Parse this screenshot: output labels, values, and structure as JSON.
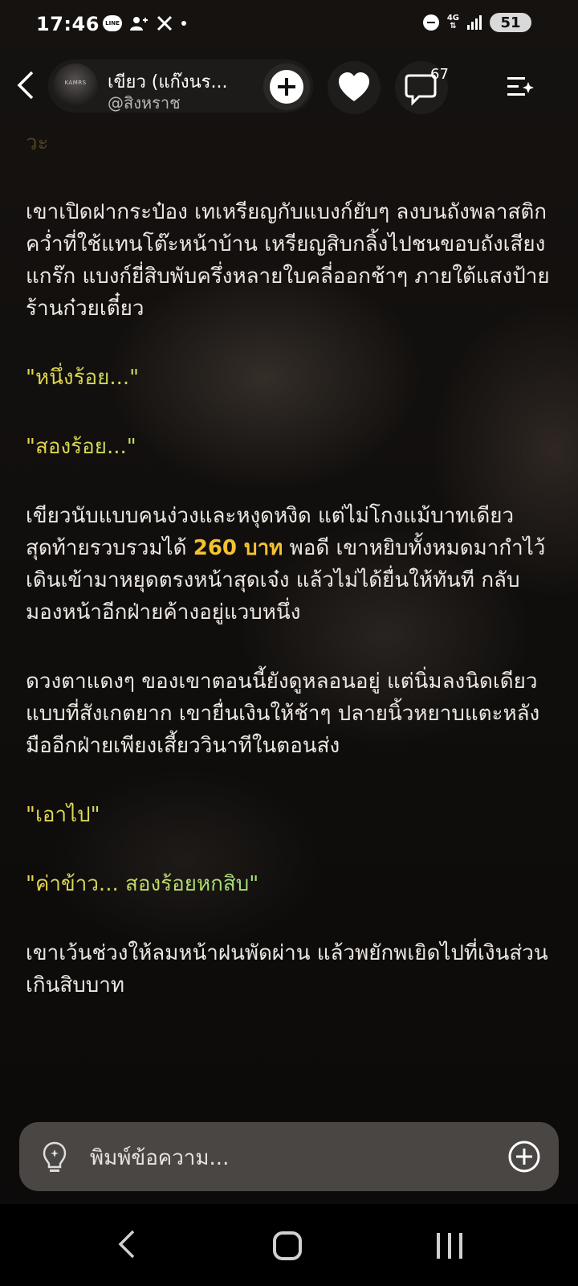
{
  "status_bar": {
    "time": "17:46",
    "line_label": "LINE",
    "network": "4G",
    "battery": "51",
    "icons": [
      "line-icon",
      "person-add-icon",
      "x-icon",
      "dot-icon",
      "dnd-icon",
      "network-icon",
      "signal-icon",
      "battery-icon"
    ]
  },
  "header": {
    "name": "เขียว (แก๊งนร...",
    "handle": "@สิงหราช",
    "comment_count": "67",
    "avatar_text": "KAMRS"
  },
  "content": {
    "faded_line": "วะ",
    "p1": "เขาเปิดฝากระป๋อง เทเหรียญกับแบงก์ยับๆ ลงบนถังพลาสติกคว่ำที่ใช้แทนโต๊ะหน้าบ้าน เหรียญสิบกลิ้งไปชนขอบถังเสียงแกร๊ก แบงก์ยี่สิบพับครึ่งหลายใบคลี่ออกช้าๆ ภายใต้แสงป้ายร้านก๋วยเตี๋ยว",
    "q1": "\"หนึ่งร้อย...\"",
    "q2": "\"สองร้อย...\"",
    "p2_before": "เขียวนับแบบคนง่วงและหงุดหงิด แต่ไม่โกงแม้บาทเดียว สุดท้ายรวบรวมได้ ",
    "p2_highlight": "260 บาท",
    "p2_after": " พอดี เขาหยิบทั้งหมดมากำไว้ เดินเข้ามาหยุดตรงหน้าสุดเจ๋ง แล้วไม่ได้ยื่นให้ทันที กลับมองหน้าอีกฝ่ายค้างอยู่แวบหนึ่ง",
    "p3": "ดวงตาแดงๆ ของเขาตอนนี้ยังดูหลอนอยู่ แต่นิ่มลงนิดเดียวแบบที่สังเกตยาก เขายื่นเงินให้ช้าๆ ปลายนิ้วหยาบแตะหลังมืออีกฝ่ายเพียงเสี้ยววินาทีในตอนส่ง",
    "q3": "\"เอาไป\"",
    "q4": "\"ค่าข้าว... สองร้อยหกสิบ\"",
    "p4": "เขาเว้นช่วงให้ลมหน้าฝนพัดผ่าน แล้วพยักพเยิดไปที่เงินส่วนเกินสิบบาท"
  },
  "input": {
    "placeholder": "พิมพ์ข้อความ..."
  },
  "colors": {
    "highlight": "#f5c231",
    "quote_gradient_start": "#e7d64c",
    "quote_gradient_end": "#4fd3d8",
    "input_bg": "#4a4644"
  }
}
